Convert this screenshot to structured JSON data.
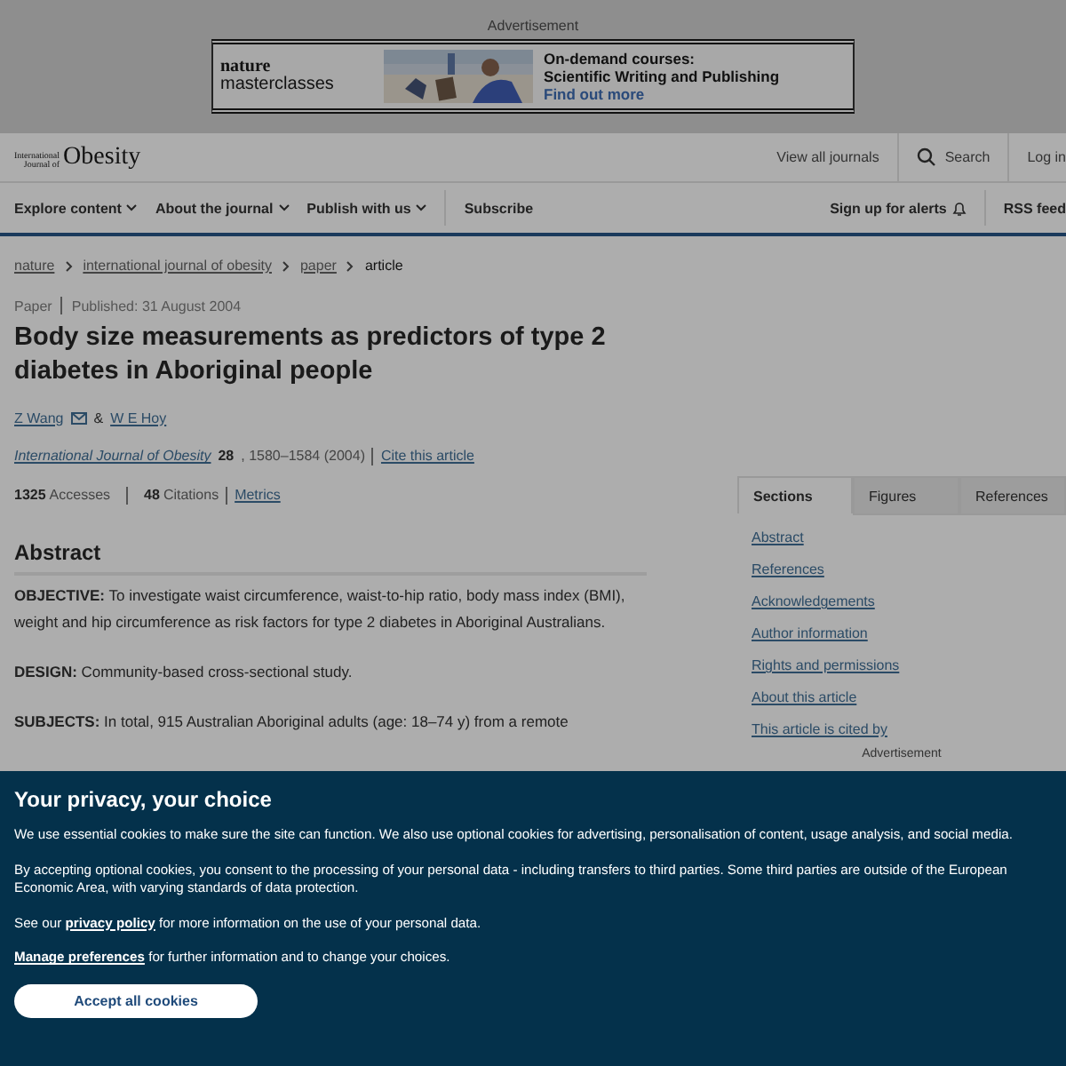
{
  "top_ad": {
    "label": "Advertisement",
    "brand_line_1": "nature",
    "brand_line_2": "masterclasses",
    "headline_1": "On-demand courses:",
    "headline_2": "Scientific Writing and Publishing",
    "link": "Find out more"
  },
  "header": {
    "logo_small_1": "International",
    "logo_small_2": "Journal of",
    "logo_big": "Obesity",
    "links": [
      {
        "label": "View all journals",
        "kind": "text"
      },
      {
        "label": "Search",
        "kind": "search"
      },
      {
        "label": "Log in",
        "kind": "text"
      }
    ]
  },
  "nav": {
    "menus": [
      {
        "label": "Explore content",
        "dropdown": true
      },
      {
        "label": "About the journal",
        "dropdown": true
      },
      {
        "label": "Publish with us",
        "dropdown": true
      },
      {
        "label": "Subscribe",
        "dropdown": false
      }
    ],
    "right": [
      {
        "label": "Sign up for alerts",
        "kind": "bell"
      },
      {
        "label": "RSS feed",
        "kind": "text"
      }
    ]
  },
  "breadcrumbs": [
    {
      "label": "nature",
      "current": false
    },
    {
      "label": "international journal of obesity",
      "current": false
    },
    {
      "label": "paper",
      "current": false
    },
    {
      "label": "article",
      "current": true
    }
  ],
  "article": {
    "type": "Paper",
    "published": "Published: 31 August 2004",
    "title": "Body size measurements as predictors of type 2 diabetes in Aboriginal people",
    "authors": [
      {
        "name": "Z Wang",
        "email": true
      },
      {
        "name": "W E Hoy",
        "email": false
      }
    ],
    "author_separator": "&",
    "journal": "International Journal of Obesity",
    "volume": "28",
    "pages": ", 1580–1584 (2004)",
    "cite": "Cite this article",
    "metrics": [
      {
        "value": "1325",
        "label": "Accesses"
      },
      {
        "value": "48",
        "label": "Citations"
      }
    ],
    "metrics_link": "Metrics",
    "abstract_heading": "Abstract",
    "abstract": [
      "**OBJECTIVE:** To investigate waist circumference, waist-to-hip ratio, body mass index (BMI), weight and hip circumference as risk factors for type 2 diabetes in Aboriginal Australians.",
      "**DESIGN:** Community-based cross-sectional study.",
      "**SUBJECTS:** In total, 915 Australian Aboriginal adults (age: 18–74 y) from a remote"
    ]
  },
  "sidebar": {
    "tabs": [
      {
        "label": "Sections",
        "selected": true
      },
      {
        "label": "Figures",
        "selected": false
      },
      {
        "label": "References",
        "selected": false
      }
    ],
    "links": [
      "Abstract",
      "References",
      "Acknowledgements",
      "Author information",
      "Rights and permissions",
      "About this article",
      "This article is cited by"
    ],
    "ad_label": "Advertisement"
  },
  "cookie_banner": {
    "title": "Your privacy, your choice",
    "paragraph_1": "We use essential cookies to make sure the site can function. We also use optional cookies for advertising, personalisation of content, usage analysis, and social media.",
    "paragraph_2": "By accepting optional cookies, you consent to the processing of your personal data - including transfers to third parties. Some third parties are outside of the European Economic Area, with varying standards of data protection.",
    "paragraph_3_before": "See our",
    "privacy_link": "privacy policy",
    "paragraph_3_after": "for more information on the use of your personal data.",
    "manage_link": "Manage preferences",
    "manage_after": "for further information and to change your choices.",
    "accept_button": "Accept all cookies"
  }
}
